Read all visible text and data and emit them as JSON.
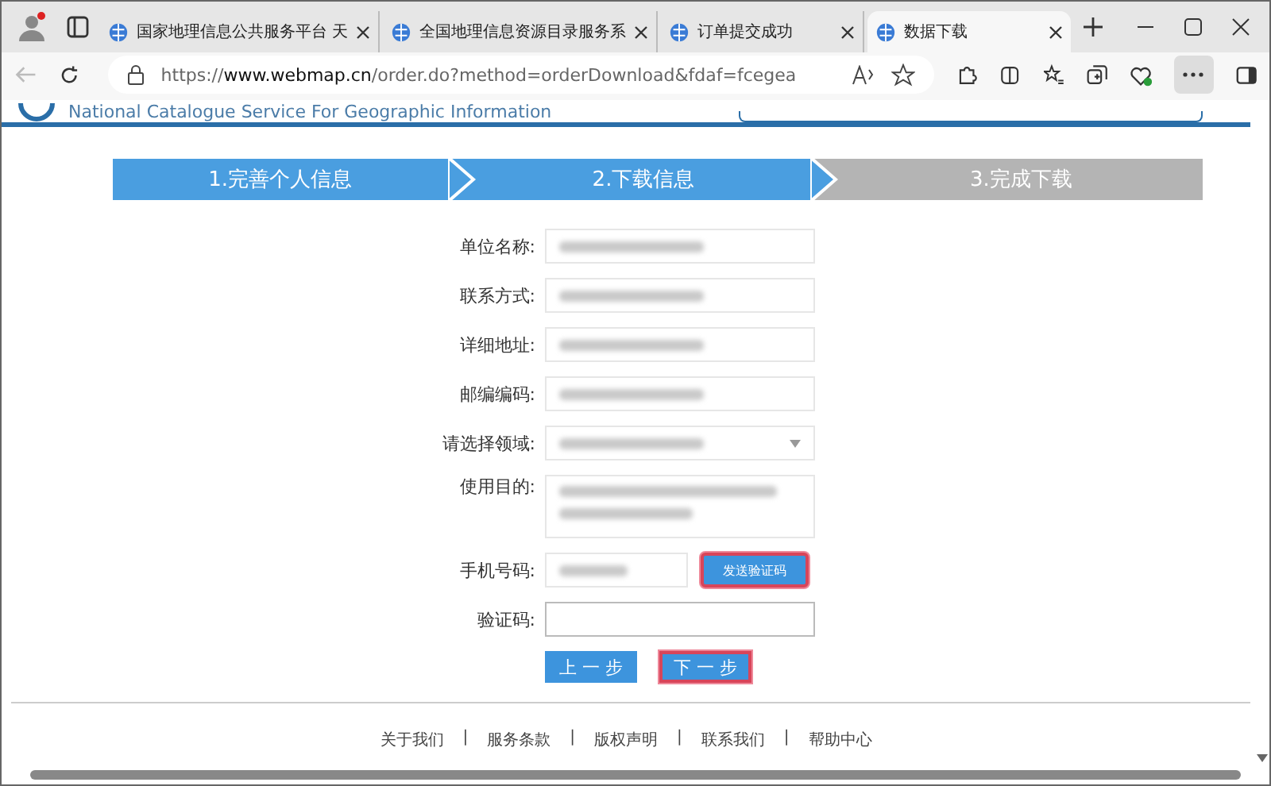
{
  "browser": {
    "tabs": [
      {
        "title": "国家地理信息公共服务平台 天",
        "selected": false
      },
      {
        "title": "全国地理信息资源目录服务系",
        "selected": false
      },
      {
        "title": "订单提交成功",
        "selected": false
      },
      {
        "title": "数据下载",
        "selected": true
      }
    ],
    "url_prefix": "https://",
    "url_host": "www.webmap.cn",
    "url_path": "/order.do?method=orderDownload&fdaf=fcegea"
  },
  "site_header": {
    "subtitle": "National Catalogue Service For Geographic Information"
  },
  "steps": [
    {
      "label": "1.完善个人信息",
      "reached": true
    },
    {
      "label": "2.下载信息",
      "reached": true
    },
    {
      "label": "3.完成下载",
      "reached": false
    }
  ],
  "form": [
    {
      "label": "单位名称:",
      "kind": "text",
      "blurred": true
    },
    {
      "label": "联系方式:",
      "kind": "text",
      "blurred": true
    },
    {
      "label": "详细地址:",
      "kind": "text",
      "blurred": true
    },
    {
      "label": "邮编编码:",
      "kind": "text",
      "blurred": true
    },
    {
      "label": "请选择领域:",
      "kind": "select",
      "blurred": true
    },
    {
      "label": "使用目的:",
      "kind": "textarea",
      "blurred": true
    },
    {
      "label": "手机号码:",
      "kind": "phone",
      "blurred": true,
      "button": "发送验证码",
      "highlighted": true
    },
    {
      "label": "验证码:",
      "kind": "text",
      "blurred": false
    }
  ],
  "buttons": [
    {
      "label": "上 一 步",
      "highlighted": false
    },
    {
      "label": "下 一 步",
      "highlighted": true
    }
  ],
  "footer_separator": "|",
  "footer_links": [
    "关于我们",
    "服务条款",
    "版权声明",
    "联系我们",
    "帮助中心"
  ]
}
